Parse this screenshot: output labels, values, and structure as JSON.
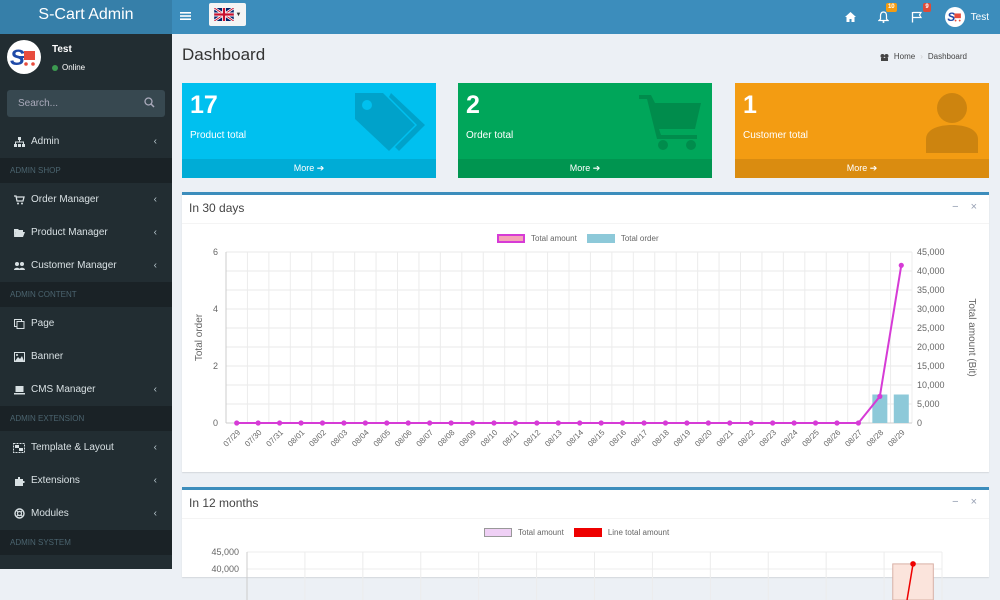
{
  "app": {
    "title": "S-Cart Admin"
  },
  "topbar": {
    "language": "en-GB",
    "notifications_count": "10",
    "flags_count": "9",
    "user_name": "Test"
  },
  "sidebar": {
    "user": {
      "name": "Test",
      "status": "Online"
    },
    "search_placeholder": "Search...",
    "items": [
      {
        "type": "item",
        "label": "Admin",
        "icon": "sitemap-icon",
        "chevron": true
      },
      {
        "type": "header",
        "label": "ADMIN SHOP"
      },
      {
        "type": "item",
        "label": "Order Manager",
        "icon": "cart-icon",
        "chevron": true
      },
      {
        "type": "item",
        "label": "Product Manager",
        "icon": "folder-open-icon",
        "chevron": true
      },
      {
        "type": "item",
        "label": "Customer Manager",
        "icon": "users-icon",
        "chevron": true
      },
      {
        "type": "header",
        "label": "ADMIN CONTENT"
      },
      {
        "type": "item",
        "label": "Page",
        "icon": "copy-icon",
        "chevron": false
      },
      {
        "type": "item",
        "label": "Banner",
        "icon": "image-icon",
        "chevron": false
      },
      {
        "type": "item",
        "label": "CMS Manager",
        "icon": "laptop-icon",
        "chevron": true
      },
      {
        "type": "header",
        "label": "ADMIN EXTENSION"
      },
      {
        "type": "item",
        "label": "Template & Layout",
        "icon": "object-group-icon",
        "chevron": true
      },
      {
        "type": "item",
        "label": "Extensions",
        "icon": "puzzle-icon",
        "chevron": true
      },
      {
        "type": "item",
        "label": "Modules",
        "icon": "life-ring-icon",
        "chevron": true
      },
      {
        "type": "header",
        "label": "ADMIN SYSTEM"
      }
    ]
  },
  "page": {
    "title": "Dashboard",
    "breadcrumb": [
      "Home",
      "Dashboard"
    ]
  },
  "stats": [
    {
      "value": "17",
      "label": "Product total",
      "more": "More",
      "color": "#00c0ef",
      "icon": "tags-icon"
    },
    {
      "value": "2",
      "label": "Order total",
      "more": "More",
      "color": "#00a65a",
      "icon": "shopping-cart-icon"
    },
    {
      "value": "1",
      "label": "Customer total",
      "more": "More",
      "color": "#f39c12",
      "icon": "user-icon"
    }
  ],
  "panels": {
    "days30": {
      "title": "In 30 days",
      "minimize": "−",
      "close": "×"
    },
    "months12": {
      "title": "In 12 months",
      "minimize": "−",
      "close": "×"
    }
  },
  "chart_data": [
    {
      "type": "bar",
      "title": "In 30 days",
      "legend": [
        "Total amount",
        "Total order"
      ],
      "legend_position": "top",
      "colors": {
        "Total amount": "#d63bd6",
        "Total order": "#8dc9d9"
      },
      "categories": [
        "07/29",
        "07/30",
        "07/31",
        "08/01",
        "08/02",
        "08/03",
        "08/04",
        "08/05",
        "08/06",
        "08/07",
        "08/08",
        "08/09",
        "08/10",
        "08/11",
        "08/12",
        "08/13",
        "08/14",
        "08/15",
        "08/16",
        "08/17",
        "08/18",
        "08/19",
        "08/20",
        "08/21",
        "08/22",
        "08/23",
        "08/24",
        "08/25",
        "08/26",
        "08/27",
        "08/28",
        "08/29"
      ],
      "series": [
        {
          "name": "Total order",
          "type": "bar",
          "axis": "left",
          "values": [
            0,
            0,
            0,
            0,
            0,
            0,
            0,
            0,
            0,
            0,
            0,
            0,
            0,
            0,
            0,
            0,
            0,
            0,
            0,
            0,
            0,
            0,
            0,
            0,
            0,
            0,
            0,
            0,
            0,
            0,
            1,
            1
          ]
        },
        {
          "name": "Total amount",
          "type": "line",
          "axis": "right",
          "values": [
            0,
            0,
            0,
            0,
            0,
            0,
            0,
            0,
            0,
            0,
            0,
            0,
            0,
            0,
            0,
            0,
            0,
            0,
            0,
            0,
            0,
            0,
            0,
            0,
            0,
            0,
            0,
            0,
            0,
            0,
            7000,
            41500
          ]
        }
      ],
      "ylabel": "Total order",
      "ylim": [
        0,
        6
      ],
      "yticks": [
        "0",
        "2",
        "4",
        "6"
      ],
      "y2label": "Total amount (Bit)",
      "y2lim": [
        0,
        45000
      ],
      "y2ticks": [
        "0",
        "5,000",
        "10,000",
        "15,000",
        "20,000",
        "25,000",
        "30,000",
        "35,000",
        "40,000",
        "45,000"
      ],
      "grid": true
    },
    {
      "type": "bar",
      "title": "In 12 months",
      "legend": [
        "Total amount",
        "Line total amount"
      ],
      "legend_position": "top",
      "colors": {
        "Total amount": "#efd0f5",
        "Line total amount": "#ee0000"
      },
      "yticks_visible": [
        "45,000",
        "40,000"
      ],
      "ylim": [
        0,
        45000
      ],
      "series": [
        {
          "name": "Total amount",
          "type": "bar",
          "last_value": 41500
        },
        {
          "name": "Line total amount",
          "type": "line",
          "last_value": 41500
        }
      ],
      "grid": true
    }
  ]
}
